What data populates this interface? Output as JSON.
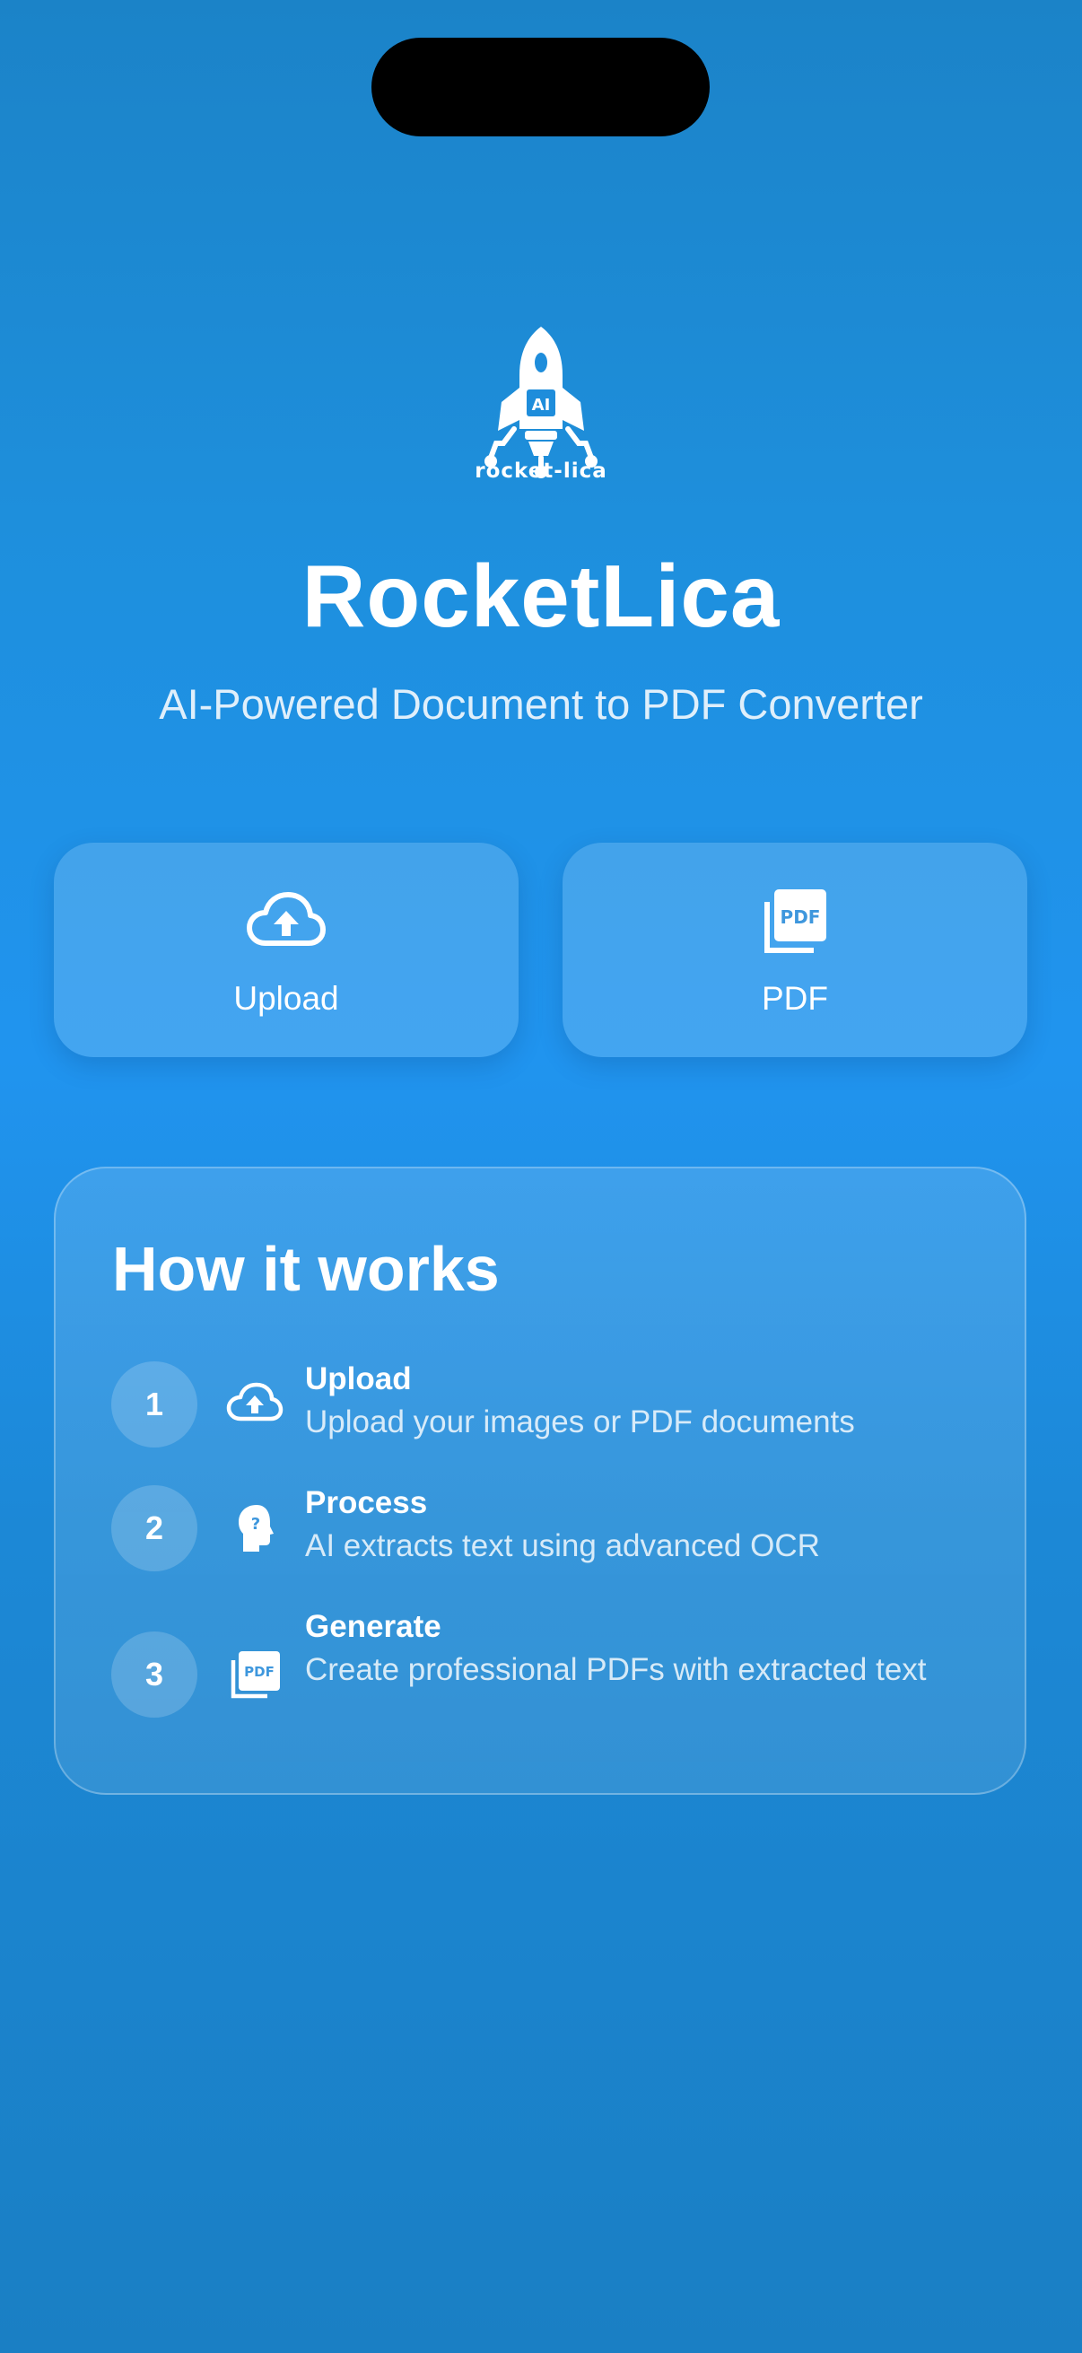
{
  "brand": {
    "logo_wordmark": "rocket-lica",
    "logo_badge": "AI",
    "title": "RocketLica",
    "subtitle": "AI-Powered Document to PDF Converter"
  },
  "actions": [
    {
      "label": "Upload",
      "icon": "cloud-upload-icon"
    },
    {
      "label": "PDF",
      "icon": "pdf-files-icon"
    }
  ],
  "how_it_works": {
    "title": "How it works",
    "steps": [
      {
        "number": "1",
        "icon": "cloud-upload-icon",
        "title": "Upload",
        "description": "Upload your images or PDF documents"
      },
      {
        "number": "2",
        "icon": "head-question-icon",
        "title": "Process",
        "description": "AI extracts text using advanced OCR"
      },
      {
        "number": "3",
        "icon": "pdf-files-icon",
        "title": "Generate",
        "description": "Create professional PDFs with extracted text"
      }
    ]
  },
  "colors": {
    "background_top": "#1b83c8",
    "background_mid": "#2094ef",
    "background_bottom": "#1a7fc4",
    "text": "#ffffff",
    "card_fill": "rgba(255,255,255,0.16)"
  }
}
